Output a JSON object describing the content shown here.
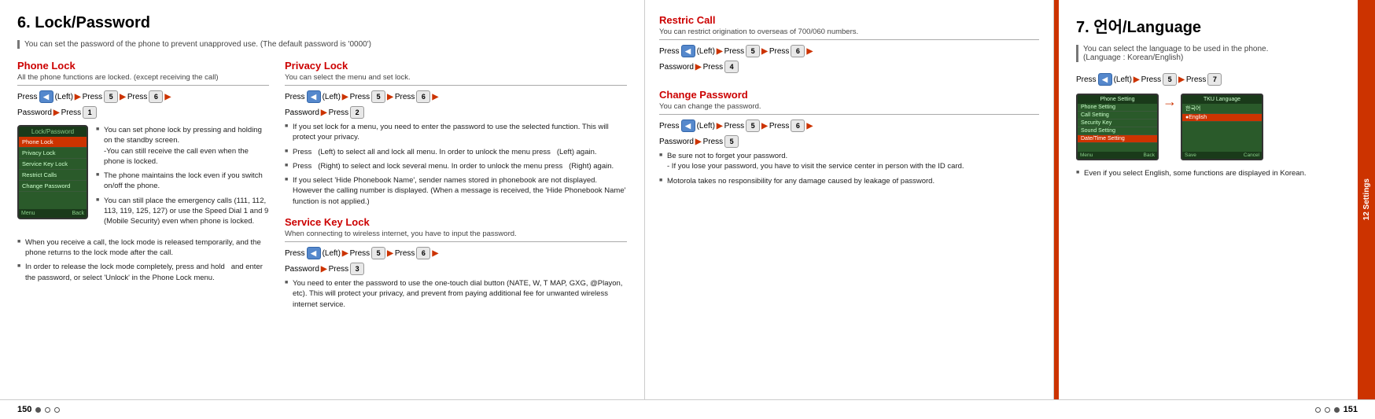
{
  "left_section": {
    "title": "6. Lock/Password",
    "subtitle": "You can set the password of the phone to prevent unapproved use. (The default password is '0000')",
    "phone_lock": {
      "title": "Phone Lock",
      "desc": "All the phone functions are locked. (except receiving the call)",
      "press_line1": [
        "Press",
        "(Left)",
        "▶",
        "Press",
        "▶",
        "Press",
        "▶"
      ],
      "press_line2": [
        "Password",
        "▶",
        "Press"
      ],
      "bullets": [
        "You can set phone lock by pressing and holding  on the standby screen.\n-You can still receive the call even when the phone is locked.",
        "The phone maintains the lock even if you switch on/off the phone.",
        "You can still place the emergency calls (111, 112, 113, 119, 125, 127) or use the Speed Dial 1 and 9 (Mobile Security) even when phone is locked."
      ],
      "bottom_bullets": [
        "When you receive a call, the lock mode is released temporarily, and the phone returns to the lock mode after the call.",
        "In order to release the lock mode completely, press and hold  and enter the password, or select 'Unlock' in the Phone Lock menu."
      ]
    }
  },
  "middle_section": {
    "privacy_lock": {
      "title": "Privacy Lock",
      "desc": "You can select the menu and set lock.",
      "press_line1": [
        "Press",
        "(Left)",
        "▶",
        "Press",
        "▶",
        "Press",
        "▶"
      ],
      "press_line2": [
        "Password",
        "▶",
        "Press"
      ],
      "bullets": [
        "If you set lock for a menu, you need to enter the password to use the selected function. This will protect your privacy.",
        "Press  (Left) to select all and lock all menu. In order to unlock the menu press  (Left) again.",
        "Press  (Right) to select and lock several menu. In order to unlock the menu press  (Right) again.",
        "If you select 'Hide Phonebook Name', sender names stored in phonebook are not displayed. However the calling number is displayed. (When a message is received, the 'Hide Phonebook Name' function is not applied.)"
      ]
    },
    "service_key_lock": {
      "title": "Service Key Lock",
      "desc": "When connecting to wireless internet, you have to input the password.",
      "press_line1": [
        "Press",
        "(Left)",
        "▶",
        "Press",
        "▶",
        "Press",
        "▶"
      ],
      "press_line2": [
        "Password",
        "▶",
        "Press"
      ],
      "bullets": [
        "You need to enter the password to use the one-touch dial button (NATE, W, T MAP, GXG, @Playon, etc). This will protect your privacy, and prevent from paying additional fee for unwanted wireless internet service."
      ]
    }
  },
  "right_col": {
    "restric_call": {
      "title": "Restric Call",
      "desc": "You can restrict origination to overseas of 700/060 numbers.",
      "press_line1": [
        "Press",
        "(Left)",
        "▶",
        "Press",
        "▶",
        "Press",
        "▶"
      ],
      "press_line2": [
        "Password",
        "▶",
        "Press"
      ]
    },
    "change_password": {
      "title": "Change Password",
      "desc": "You can change the password.",
      "press_line1": [
        "Press",
        "(Left)",
        "▶",
        "Press",
        "▶",
        "Press",
        "▶"
      ],
      "press_line2": [
        "Password",
        "▶",
        "Press"
      ],
      "bullets": [
        "Be sure not to forget your password.\n - If you lose your password, you have to visit the service center in person with the ID card.",
        "Motorola takes no responsibility for any damage caused by leakage of password."
      ]
    }
  },
  "language_section": {
    "title": "7. 언어/Language",
    "subtitle": "You can select the language to be used in the phone.\n(Language : Korean/English)",
    "press_line": [
      "Press",
      "(Left)",
      "▶",
      "Press",
      "▶",
      "Press"
    ],
    "screen1_items": [
      "Phone Setting",
      "Call Setting",
      "Security Key",
      "Sound Setting",
      "Date/Time Setting"
    ],
    "screen2_items": [
      "한국어",
      "English"
    ],
    "active_item": "English",
    "bullets": [
      "Even if you select English, some functions are displayed in Korean."
    ]
  },
  "sidebar": {
    "label": "12 Settings"
  },
  "page_left": "150",
  "page_right": "151"
}
